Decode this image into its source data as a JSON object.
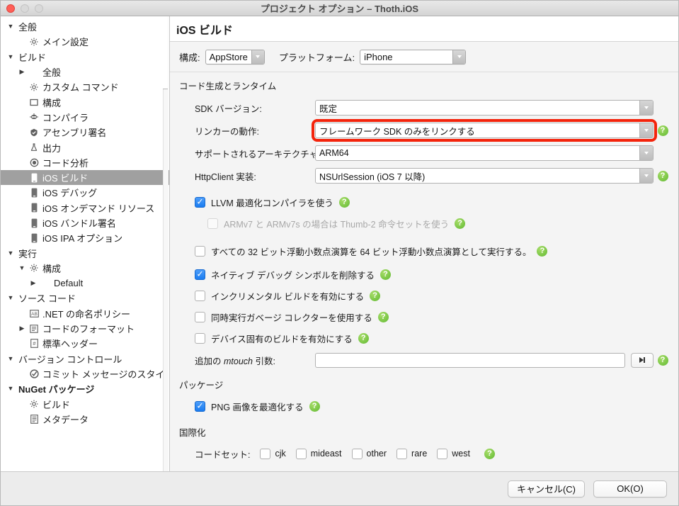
{
  "window": {
    "title": "プロジェクト オプション – Thoth.iOS",
    "traffic": {
      "close": "close-button",
      "minimize": "minimize-button",
      "maximize": "maximize-button"
    }
  },
  "sidebar": {
    "items": [
      {
        "label": "全般",
        "indent": 0,
        "disclosure": "▼",
        "icon": "",
        "bold": false,
        "selected": false
      },
      {
        "label": "メイン設定",
        "indent": 1,
        "disclosure": "",
        "icon": "gear-icon",
        "bold": false,
        "selected": false
      },
      {
        "label": "ビルド",
        "indent": 0,
        "disclosure": "▼",
        "icon": "",
        "bold": false,
        "selected": false
      },
      {
        "label": "全般",
        "indent": 1,
        "disclosure": "▶",
        "icon": "",
        "bold": false,
        "selected": false
      },
      {
        "label": "カスタム コマンド",
        "indent": 1,
        "disclosure": "",
        "icon": "gear-icon",
        "bold": false,
        "selected": false
      },
      {
        "label": "構成",
        "indent": 1,
        "disclosure": "",
        "icon": "square-icon",
        "bold": false,
        "selected": false
      },
      {
        "label": "コンパイラ",
        "indent": 1,
        "disclosure": "",
        "icon": "robot-icon",
        "bold": false,
        "selected": false
      },
      {
        "label": "アセンブリ署名",
        "indent": 1,
        "disclosure": "",
        "icon": "badge-icon",
        "bold": false,
        "selected": false
      },
      {
        "label": "出力",
        "indent": 1,
        "disclosure": "",
        "icon": "flask-icon",
        "bold": false,
        "selected": false
      },
      {
        "label": "コード分析",
        "indent": 1,
        "disclosure": "",
        "icon": "radio-icon",
        "bold": false,
        "selected": false
      },
      {
        "label": "iOS ビルド",
        "indent": 1,
        "disclosure": "",
        "icon": "phone-icon",
        "bold": false,
        "selected": true
      },
      {
        "label": "iOS デバッグ",
        "indent": 1,
        "disclosure": "",
        "icon": "phone-icon",
        "bold": false,
        "selected": false
      },
      {
        "label": "iOS オンデマンド リソース",
        "indent": 1,
        "disclosure": "",
        "icon": "phone-icon",
        "bold": false,
        "selected": false
      },
      {
        "label": "iOS バンドル署名",
        "indent": 1,
        "disclosure": "",
        "icon": "phone-icon",
        "bold": false,
        "selected": false
      },
      {
        "label": "iOS IPA オプション",
        "indent": 1,
        "disclosure": "",
        "icon": "phone-icon",
        "bold": false,
        "selected": false
      },
      {
        "label": "実行",
        "indent": 0,
        "disclosure": "▼",
        "icon": "",
        "bold": false,
        "selected": false
      },
      {
        "label": "構成",
        "indent": 1,
        "disclosure": "▼",
        "icon": "gear-icon",
        "bold": false,
        "selected": false
      },
      {
        "label": "Default",
        "indent": 2,
        "disclosure": "▶",
        "icon": "",
        "bold": false,
        "selected": false
      },
      {
        "label": "ソース コード",
        "indent": 0,
        "disclosure": "▼",
        "icon": "",
        "bold": false,
        "selected": false
      },
      {
        "label": ".NET の命名ポリシー",
        "indent": 1,
        "disclosure": "",
        "icon": "ab-icon",
        "bold": false,
        "selected": false
      },
      {
        "label": "コードのフォーマット",
        "indent": 1,
        "disclosure": "▶",
        "icon": "list-icon",
        "bold": false,
        "selected": false
      },
      {
        "label": "標準ヘッダー",
        "indent": 1,
        "disclosure": "",
        "icon": "hash-doc-icon",
        "bold": false,
        "selected": false
      },
      {
        "label": "バージョン コントロール",
        "indent": 0,
        "disclosure": "▼",
        "icon": "",
        "bold": false,
        "selected": false
      },
      {
        "label": "コミット メッセージのスタイル",
        "indent": 1,
        "disclosure": "",
        "icon": "check-circle-icon",
        "bold": false,
        "selected": false
      },
      {
        "label": "NuGet パッケージ",
        "indent": 0,
        "disclosure": "▼",
        "icon": "",
        "bold": true,
        "selected": false
      },
      {
        "label": "ビルド",
        "indent": 1,
        "disclosure": "",
        "icon": "gear-icon",
        "bold": false,
        "selected": false
      },
      {
        "label": "メタデータ",
        "indent": 1,
        "disclosure": "",
        "icon": "doc-lines-icon",
        "bold": false,
        "selected": false
      }
    ]
  },
  "panel": {
    "header": "iOS ビルド",
    "config": {
      "config_label": "構成:",
      "config_value": "AppStore",
      "platform_label": "プラットフォーム:",
      "platform_value": "iPhone"
    },
    "section_codegen": "コード生成とランタイム",
    "fields": [
      {
        "label": "SDK バージョン:",
        "value": "既定",
        "help": false,
        "highlight": false
      },
      {
        "label": "リンカーの動作:",
        "value": "フレームワーク SDK のみをリンクする",
        "help": true,
        "highlight": true
      },
      {
        "label": "サポートされるアーキテクチャ:",
        "value": "ARM64",
        "help": false,
        "highlight": false
      },
      {
        "label": "HttpClient 実装:",
        "value": "NSUrlSession (iOS 7 以降)",
        "help": true,
        "highlight": false
      }
    ],
    "checkboxes": [
      {
        "label": "LLVM 最適化コンパイラを使う",
        "checked": true,
        "disabled": false,
        "indent": false,
        "help": true
      },
      {
        "label": "ARMv7 と ARMv7s の場合は Thumb-2 命令セットを使う",
        "checked": false,
        "disabled": true,
        "indent": true,
        "help": true
      },
      {
        "label": "すべての 32 ビット浮動小数点演算を 64 ビット浮動小数点演算として実行する。",
        "checked": false,
        "disabled": false,
        "indent": false,
        "help": true
      },
      {
        "label": "ネイティブ デバッグ シンボルを削除する",
        "checked": true,
        "disabled": false,
        "indent": false,
        "help": true
      },
      {
        "label": "インクリメンタル ビルドを有効にする",
        "checked": false,
        "disabled": false,
        "indent": false,
        "help": true
      },
      {
        "label": "同時実行ガベージ コレクターを使用する",
        "checked": false,
        "disabled": false,
        "indent": false,
        "help": true
      },
      {
        "label": "デバイス固有のビルドを有効にする",
        "checked": false,
        "disabled": false,
        "indent": false,
        "help": true
      }
    ],
    "mtouch": {
      "label_prefix": "追加の ",
      "label_italic": "mtouch",
      "label_suffix": " 引数:",
      "value": "",
      "button_icon": "expand-arrow-icon",
      "help": true
    },
    "section_package": "パッケージ",
    "package_checkbox": {
      "label": "PNG 画像を最適化する",
      "checked": true,
      "help": true
    },
    "section_i18n": "国際化",
    "codeset": {
      "label": "コードセット:",
      "options": [
        {
          "label": "cjk",
          "checked": false
        },
        {
          "label": "mideast",
          "checked": false
        },
        {
          "label": "other",
          "checked": false
        },
        {
          "label": "rare",
          "checked": false
        },
        {
          "label": "west",
          "checked": false
        }
      ],
      "help": true
    }
  },
  "footer": {
    "cancel_label": "キャンセル(C)",
    "ok_label": "OK(O)"
  },
  "colors": {
    "highlight_red": "#f4240c",
    "checkbox_blue": "#1a7cf0",
    "help_green": "#76c442",
    "selection_gray": "#a0a0a0"
  },
  "help_glyph": "?"
}
